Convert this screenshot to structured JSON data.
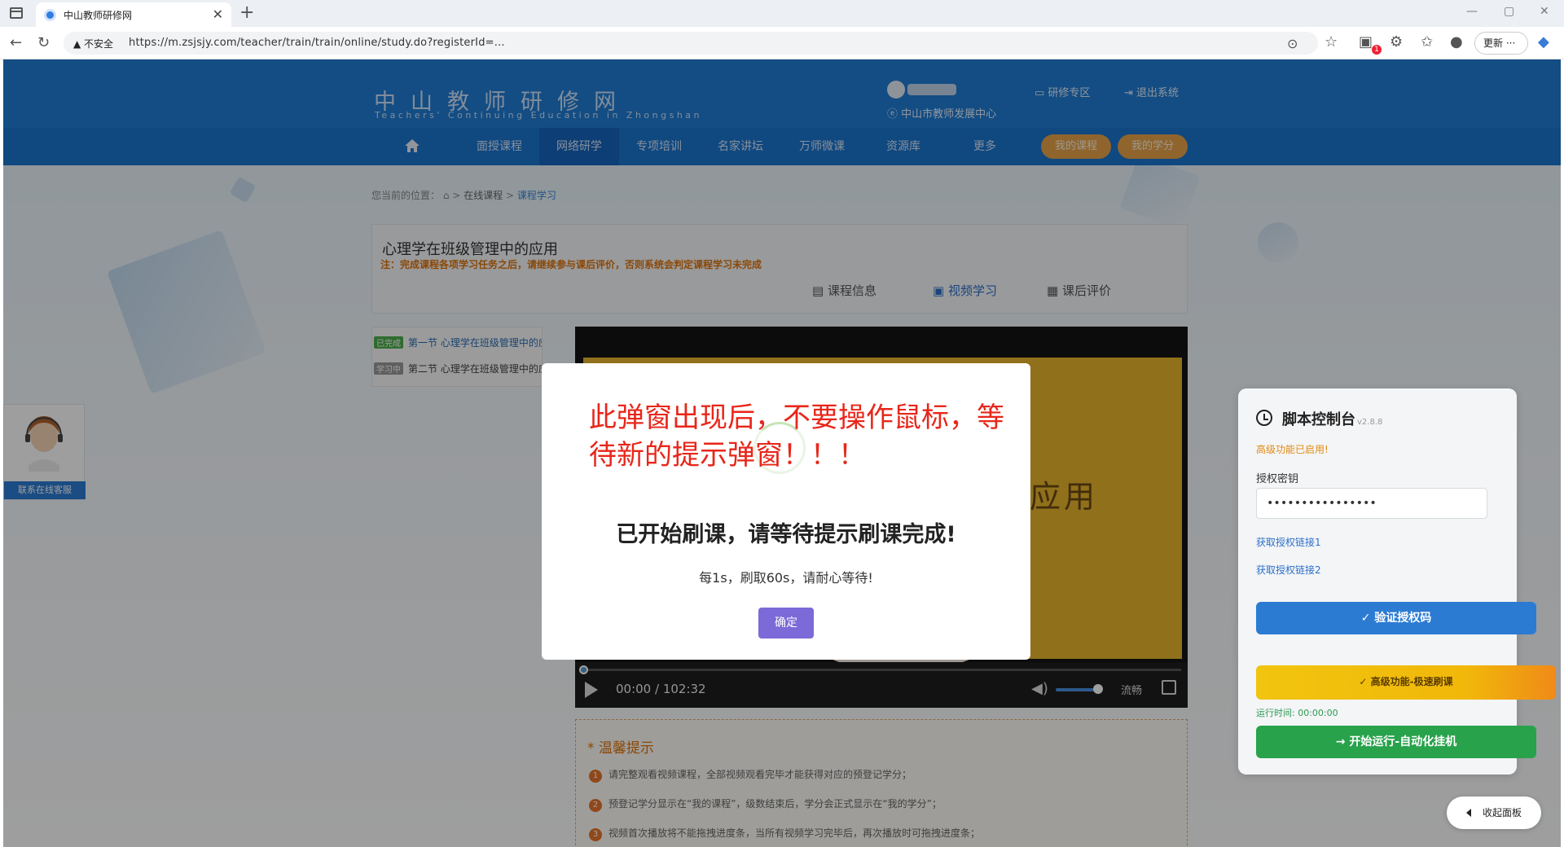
{
  "browser": {
    "tab_title": "中山教师研修网",
    "url_warning": "不安全",
    "url": "https://m.zsjsjy.com/teacher/train/train/online/study.do?registerId=...",
    "update_label": "更新",
    "notif_badge": "1"
  },
  "header": {
    "site_title": "中山教师研修网",
    "site_subtitle": "Teachers' Continuing Education in Zhongshan",
    "center_name": "中山市教师发展中心",
    "links": [
      "研修专区",
      "退出系统"
    ]
  },
  "nav": {
    "items": [
      "面授课程",
      "网络研学",
      "专项培训",
      "名家讲坛",
      "万师微课",
      "资源库",
      "更多"
    ],
    "active_index": 1,
    "pills": [
      "我的课程",
      "我的学分"
    ]
  },
  "breadcrumb": {
    "prefix": "您当前的位置：",
    "items": [
      "在线课程",
      "课程学习"
    ],
    "sep": ">"
  },
  "course": {
    "title": "心理学在班级管理中的应用",
    "note": "注：完成课程各项学习任务之后，请继续参与课后评价，否则系统会判定课程学习未完成",
    "tabs": [
      "课程信息",
      "视频学习",
      "课后评价"
    ]
  },
  "lessons": [
    {
      "tag": "已完成",
      "title": "第一节 心理学在班级管理中的应用"
    },
    {
      "tag": "学习中",
      "title": "第二节 心理学在班级管理中的应用"
    }
  ],
  "video": {
    "frame_text": "应用",
    "time": "00:00 / 102:32",
    "quality": "流畅",
    "progress": 0
  },
  "notice": {
    "title": "* 温馨提示",
    "items": [
      {
        "n": "1",
        "text": "请完整观看视频课程，全部视频观看完毕才能获得对应的预登记学分；"
      },
      {
        "n": "2",
        "text": "预登记学分显示在“我的课程”，级数结束后，学分会正式显示在“我的学分”；"
      },
      {
        "n": "3",
        "text": "视频首次播放将不能拖拽进度条，当所有视频学习完毕后，再次播放时可拖拽进度条；"
      }
    ]
  },
  "customer_service": {
    "label": "联系在线客服"
  },
  "panel": {
    "title": "脚本控制台",
    "version": "v2.8.8",
    "status": "高级功能已启用!",
    "key_label": "授权密钥",
    "key_value": "••••••••••••••••",
    "link1": "获取授权链接1",
    "link2": "获取授权链接2",
    "verify_btn": "验证授权码",
    "advanced_btn": "高级功能-极速刷课",
    "run_time": "运行时间: 00:00:00",
    "start_btn": "开始运行-自动化挂机",
    "colors": {
      "verify": "#2c7bd3",
      "advanced": "#f1b80a",
      "start": "#28a24b"
    }
  },
  "collapse": {
    "label": "收起面板"
  },
  "modal": {
    "warning": "此弹窗出现后，不要操作鼠标，等待新的提示弹窗！！！",
    "heading": "已开始刷课，请等待提示刷课完成!",
    "message": "每1s，刷取60s，请耐心等待!",
    "ok": "确定",
    "accent": "#7b6ad8"
  }
}
